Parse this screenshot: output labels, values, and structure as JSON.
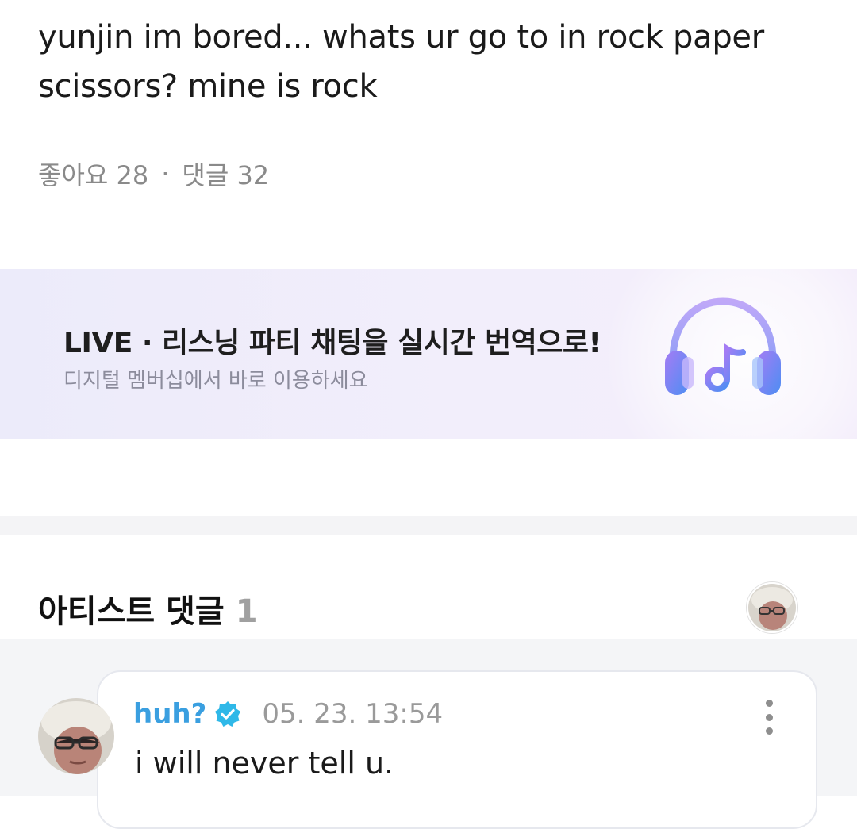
{
  "post": {
    "text": "yunjin im bored... whats ur go to in rock paper scissors? mine is rock",
    "likes_label": "좋아요 28",
    "separator": "·",
    "comments_label": "댓글 32"
  },
  "banner": {
    "title": "LIVE · 리스닝 파티 채팅을 실시간 번역으로!",
    "subtitle": "디지털 멤버십에서 바로 이용하세요",
    "icon": "headphones-music-icon"
  },
  "artist_comments": {
    "heading": "아티스트 댓글",
    "count": "1"
  },
  "comment": {
    "author": "huh?",
    "verified_icon": "verified-badge-icon",
    "date": "05. 23. 13:54",
    "text": "i will never tell u.",
    "more_icon": "more-vertical-icon"
  },
  "colors": {
    "author_name": "#3a9fe0",
    "verified_badge": "#2fb8e8",
    "headphones_gradient_start": "#9b7cf2",
    "headphones_gradient_end": "#4f8ff2"
  }
}
